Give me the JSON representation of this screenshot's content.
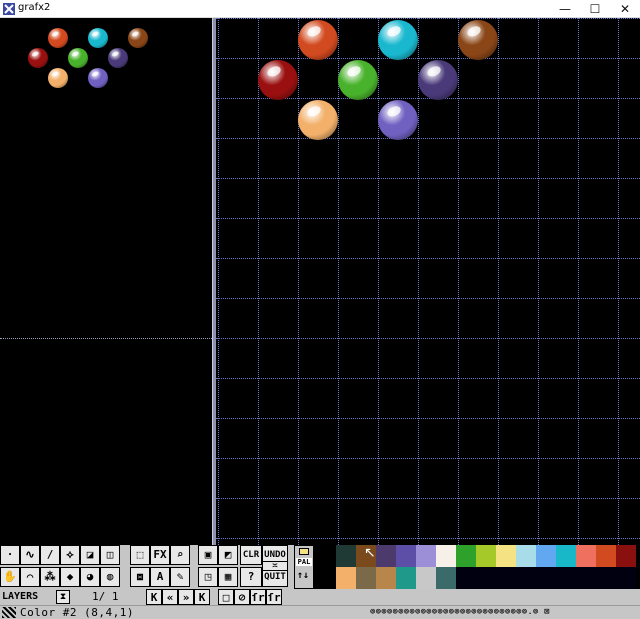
{
  "window": {
    "title": "grafx2",
    "minimize_glyph": "—",
    "maximize_glyph": "☐",
    "close_glyph": "✕"
  },
  "icons": {
    "app": "grafx2-app-icon",
    "resize_grip": "grip-icon",
    "hourglass": "hourglass-icon",
    "mouse_cursor": "arrow-cursor-icon"
  },
  "balls": [
    {
      "color": "#d24a1f"
    },
    {
      "color": "#1ab8cf"
    },
    {
      "color": "#8a4617"
    },
    {
      "color": "#9a1010"
    },
    {
      "color": "#49b22c"
    },
    {
      "color": "#4a3a7a"
    },
    {
      "color": "#f2b06a"
    },
    {
      "color": "#7060c0"
    }
  ],
  "tools": {
    "row1": [
      {
        "name": "dot-brush-tool",
        "glyph": "·"
      },
      {
        "name": "freehand-tool",
        "glyph": "∿"
      },
      {
        "name": "line-tool",
        "glyph": "/"
      },
      {
        "name": "fill-tool",
        "glyph": "⟡"
      },
      {
        "name": "filled-rect-tool",
        "glyph": "◪"
      },
      {
        "name": "rect-tool",
        "glyph": "◫"
      },
      {
        "name": "brush-grab-tool",
        "glyph": "⬚"
      },
      {
        "name": "effects-tool",
        "glyph": "FX"
      },
      {
        "name": "magnify-tool",
        "glyph": "⌕"
      },
      {
        "name": "screen-tool",
        "glyph": "▣"
      },
      {
        "name": "adjust-tool",
        "glyph": "◩"
      },
      {
        "name": "clear-tool",
        "glyph": "CLR"
      },
      {
        "name": "undo-tool",
        "glyph": "UNDO"
      }
    ],
    "row2": [
      {
        "name": "hand-tool",
        "glyph": "✋"
      },
      {
        "name": "curve-tool",
        "glyph": "⌒"
      },
      {
        "name": "spray-tool",
        "glyph": "⁂"
      },
      {
        "name": "polyfill-tool",
        "glyph": "◆"
      },
      {
        "name": "filled-circle-tool",
        "glyph": "◕"
      },
      {
        "name": "gradient-tool",
        "glyph": "◍"
      },
      {
        "name": "lasso-tool",
        "glyph": "⧈"
      },
      {
        "name": "text-tool",
        "glyph": "A"
      },
      {
        "name": "picker-tool",
        "glyph": "✎"
      },
      {
        "name": "window-tool",
        "glyph": "◳"
      },
      {
        "name": "settings-tool",
        "glyph": "▦"
      },
      {
        "name": "help-tool",
        "glyph": "?"
      },
      {
        "name": "quit-tool",
        "glyph": "QUIT"
      }
    ],
    "undo_redo_middle": "≍"
  },
  "palette": {
    "label": "PAL",
    "arrows": "↑↓",
    "row1": [
      "#000000",
      "#1f3a34",
      "#7a4a1c",
      "#4d3a6d",
      "#5d4fa8",
      "#9c8fd8",
      "#f6f0e8",
      "#2ea12a",
      "#a6c92a",
      "#f5e283",
      "#a8dce8",
      "#62a8f0",
      "#18b8c8",
      "#f07060",
      "#d24a1f",
      "#8a1010"
    ],
    "row2": [
      "#000000",
      "#f2b06a",
      "#7a6a4a",
      "#b8864a",
      "#1f9a8a",
      "#c8c8c8",
      "#3a6a6a",
      "#000010",
      "#000010",
      "#000010",
      "#000010",
      "#000010",
      "#000010",
      "#000010",
      "#000010",
      "#000010"
    ]
  },
  "layers": {
    "label": "LAYERS",
    "count": "1/    1",
    "nav": [
      "K",
      "«",
      "»",
      "K"
    ],
    "extra": [
      "□",
      "⊘",
      "ſr",
      "ſr"
    ]
  },
  "status": {
    "text": "Color #2 (8,4,1)",
    "dots": "⊚⊚⊚⊚⊚⊚⊚⊚⊚⊚⊚⊚⊚⊚⊚⊚⊚⊚⊚⊚⊚⊚⊚⊚⊚⊚⊚⊚.⊚ ⊠"
  }
}
